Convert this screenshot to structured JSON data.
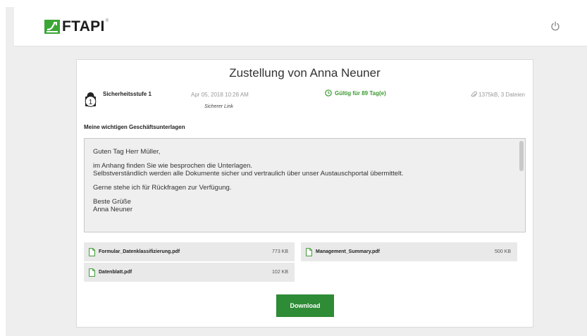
{
  "brand": {
    "name": "FTAPI",
    "registered_mark": "®"
  },
  "header": {
    "power_icon": "power-icon"
  },
  "delivery": {
    "title": "Zustellung von Anna Neuner",
    "security_level": "Sicherheitsstufe 1",
    "security_level_number": "1",
    "date": "Apr 05, 2018 10:28 AM",
    "link_type": "Sicherer Link",
    "validity": "Gültig für 89 Tag(e)",
    "size_info": "1375kB, 3 Dateien",
    "subject": "Meine wichtigen Geschäftsunterlagen"
  },
  "message": {
    "lines": [
      "Guten Tag Herr Müller,",
      "im Anhang finden Sie wie besprochen die Unterlagen.",
      "Selbstverständlich werden alle Dokumente sicher und vertraulich über unser Austauschportal übermittelt.",
      "Gerne stehe ich für Rückfragen zur Verfügung.",
      "Beste Grüße",
      "Anna Neuner"
    ]
  },
  "files": [
    {
      "name": "Formular_Datenklassifizierung.pdf",
      "size": "773 KB"
    },
    {
      "name": "Management_Summary.pdf",
      "size": "500 KB"
    },
    {
      "name": "Datenblatt.pdf",
      "size": "102 KB"
    }
  ],
  "actions": {
    "download_label": "Download"
  },
  "colors": {
    "accent_green": "#2e8b36",
    "validity_green": "#3a9a2f",
    "logo_green": "#3aa635"
  }
}
